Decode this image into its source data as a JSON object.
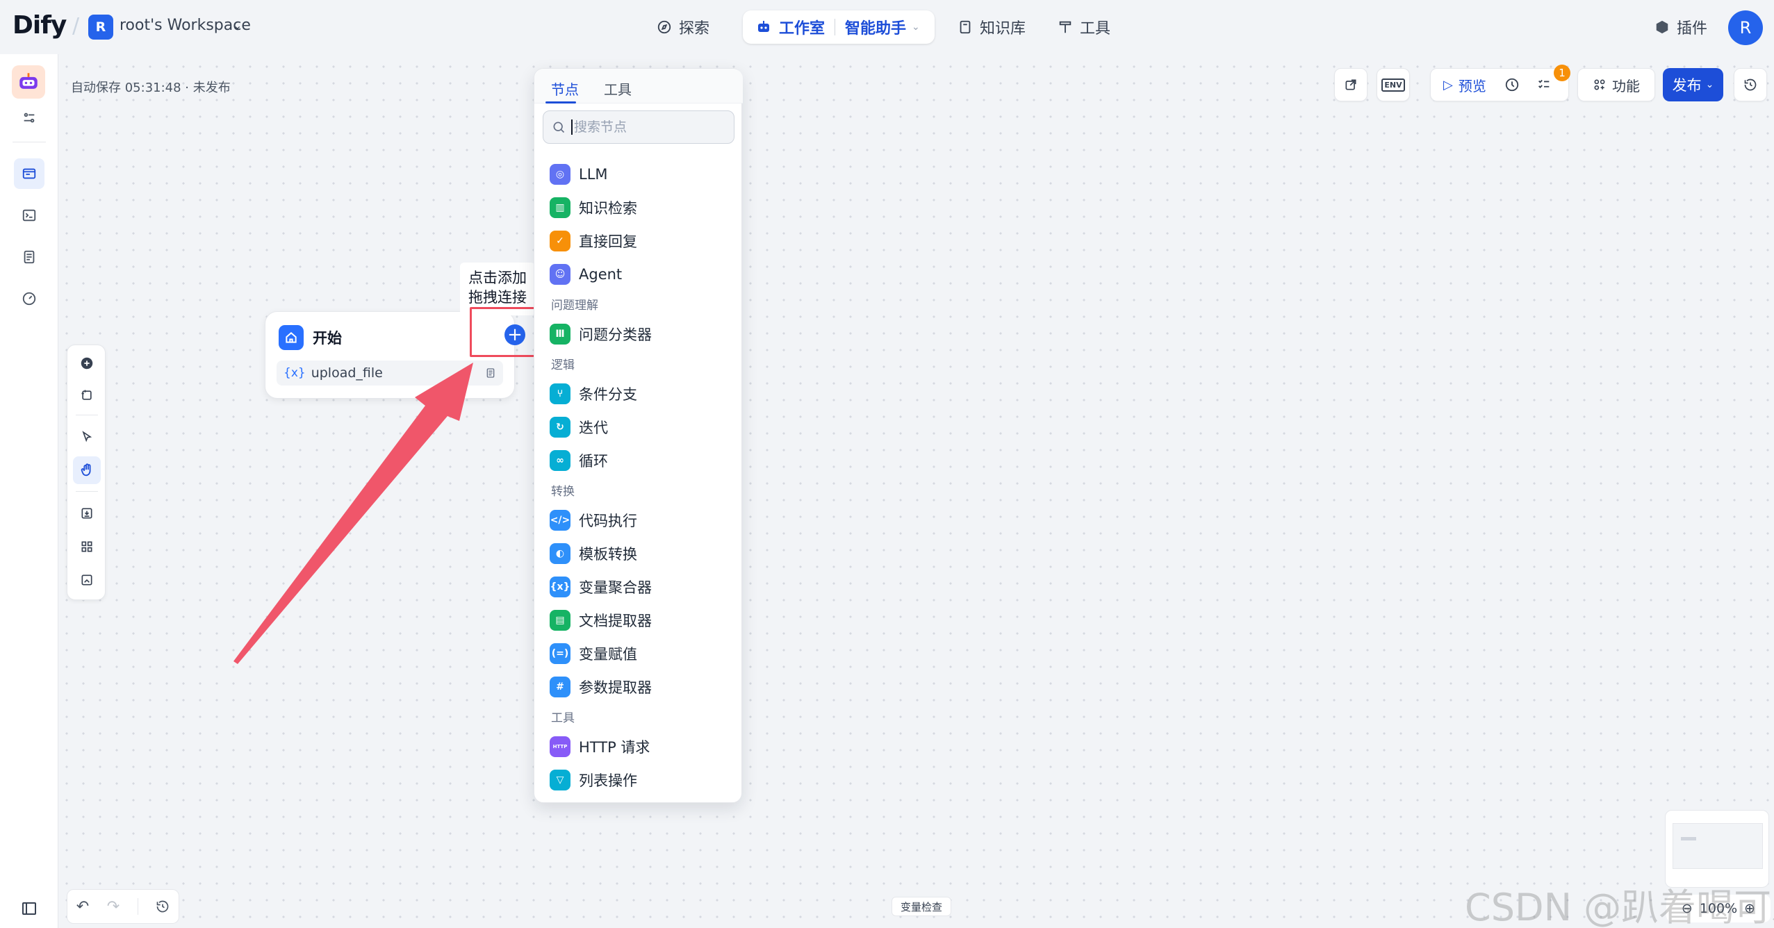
{
  "topbar": {
    "logo": "Dify",
    "workspace_initial": "R",
    "workspace_name": "root's Workspace",
    "nav": {
      "explore": "探索",
      "studio": "工作室",
      "app_name": "智能助手",
      "knowledge": "知识库",
      "tools": "工具",
      "plugins": "插件"
    },
    "user_initial": "R"
  },
  "header": {
    "autosave": "自动保存 05:31:48 · 未发布",
    "env_label": "ENV",
    "preview": "预览",
    "checklist_count": "1",
    "features": "功能",
    "publish": "发布"
  },
  "start_node": {
    "title": "开始",
    "variable_icon": "{x}",
    "variable_name": "upload_file"
  },
  "tooltip": {
    "line1": "点击添加",
    "line2": "拖拽连接"
  },
  "node_panel": {
    "tab_nodes": "节点",
    "tab_tools": "工具",
    "search_placeholder": "搜索节点",
    "items": [
      {
        "label": "LLM",
        "color": "#6172f3",
        "icon": "llm-icon"
      },
      {
        "label": "知识检索",
        "color": "#16b364",
        "icon": "knowledge-retrieval-icon"
      },
      {
        "label": "直接回复",
        "color": "#f79009",
        "icon": "answer-icon"
      },
      {
        "label": "Agent",
        "color": "#6172f3",
        "icon": "agent-icon"
      },
      {
        "label": "问题分类器",
        "color": "#16b364",
        "icon": "question-classifier-icon"
      },
      {
        "label": "条件分支",
        "color": "#06aed4",
        "icon": "if-else-icon"
      },
      {
        "label": "迭代",
        "color": "#06aed4",
        "icon": "iteration-icon"
      },
      {
        "label": "循环",
        "color": "#06aed4",
        "icon": "loop-icon"
      },
      {
        "label": "代码执行",
        "color": "#2e90fa",
        "icon": "code-icon"
      },
      {
        "label": "模板转换",
        "color": "#2e90fa",
        "icon": "template-icon"
      },
      {
        "label": "变量聚合器",
        "color": "#2e90fa",
        "icon": "variable-aggregator-icon"
      },
      {
        "label": "文档提取器",
        "color": "#16b364",
        "icon": "doc-extractor-icon"
      },
      {
        "label": "变量赋值",
        "color": "#2e90fa",
        "icon": "assigner-icon"
      },
      {
        "label": "参数提取器",
        "color": "#2e90fa",
        "icon": "parameter-extractor-icon"
      },
      {
        "label": "HTTP 请求",
        "color": "#875bf7",
        "icon": "http-icon"
      },
      {
        "label": "列表操作",
        "color": "#06aed4",
        "icon": "list-operator-icon"
      }
    ],
    "groups": {
      "question_understanding": "问题理解",
      "logic": "逻辑",
      "transform": "转换",
      "tools": "工具"
    }
  },
  "bottom": {
    "variable_inspect": "变量检查",
    "zoom": "100%",
    "watermark": "CSDN @趴着喝可乐"
  }
}
